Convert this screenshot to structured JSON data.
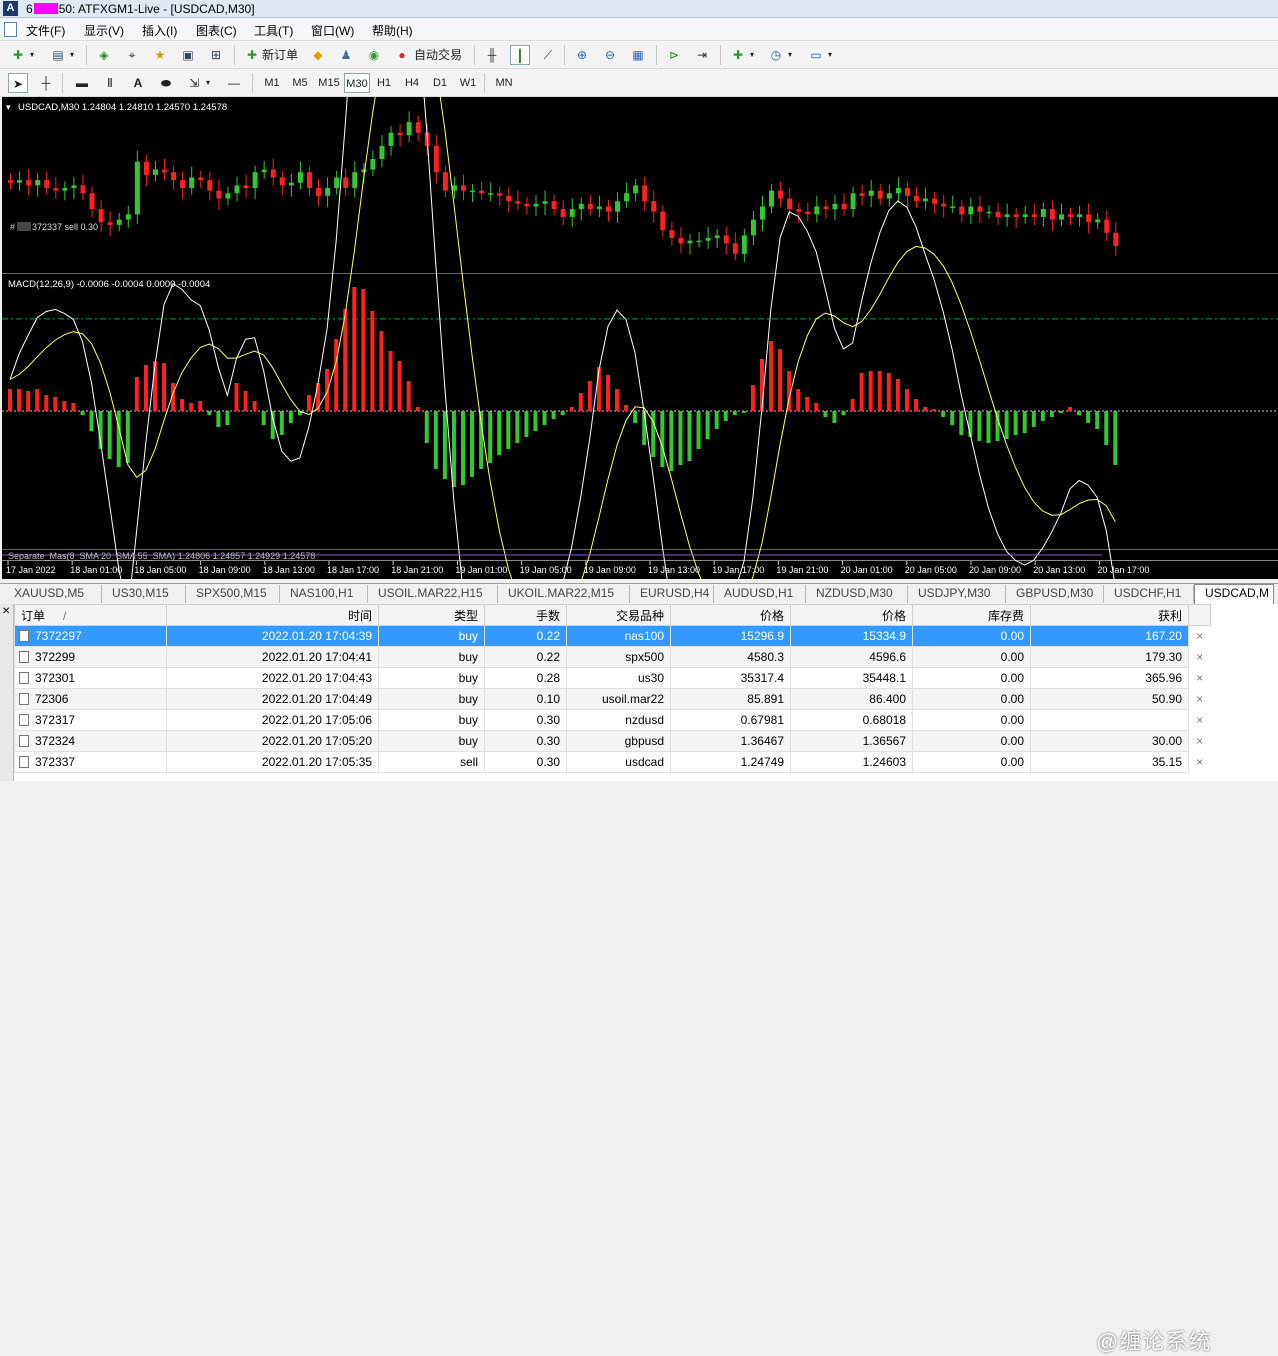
{
  "window": {
    "account_prefix": "6",
    "account_suffix": "50",
    "title_rest": ": ATFXGM1-Live - [USDCAD,M30]"
  },
  "menu": [
    "文件(F)",
    "显示(V)",
    "插入(I)",
    "图表(C)",
    "工具(T)",
    "窗口(W)",
    "帮助(H)"
  ],
  "toolbar": {
    "new_order": "新订单",
    "auto_trading": "自动交易",
    "timeframes": [
      "M1",
      "M5",
      "M15",
      "M30",
      "H1",
      "H4",
      "D1",
      "W1",
      "MN"
    ],
    "active_timeframe": "M30"
  },
  "chart": {
    "header": "USDCAD,M30  1.24804 1.24810 1.24570 1.24578",
    "order_line_label": "372337 sell 0.30",
    "order_line_prefix": "#",
    "indicator_header": "MACD(12,26,9) -0.0006 -0.0004 0.0000 -0.0004",
    "bottom_indicator_header": "Separate_Mas(8_SMA 20_SMA 55_SMA) 1.24806 1.24857 1.24929 1.24578",
    "time_labels": [
      "17 Jan 2022",
      "18 Jan 01:00",
      "18 Jan 05:00",
      "18 Jan 09:00",
      "18 Jan 13:00",
      "18 Jan 17:00",
      "18 Jan 21:00",
      "19 Jan 01:00",
      "19 Jan 05:00",
      "19 Jan 09:00",
      "19 Jan 13:00",
      "19 Jan 17:00",
      "19 Jan 21:00",
      "20 Jan 01:00",
      "20 Jan 05:00",
      "20 Jan 09:00",
      "20 Jan 13:00",
      "20 Jan 17:00"
    ],
    "colors": {
      "bull": "#32c832",
      "bear": "#ff2020",
      "macd_line": "#ffffff",
      "signal": "#ffff66",
      "order_line": "#1e9e3c"
    }
  },
  "chart_data": {
    "type": "candlestick",
    "symbol": "USDCAD",
    "timeframe": "M30",
    "closes": [
      1.2512,
      1.2513,
      1.2511,
      1.2513,
      1.251,
      1.2509,
      1.251,
      1.2511,
      1.2508,
      1.2502,
      1.2497,
      1.2496,
      1.2498,
      1.25,
      1.252,
      1.2515,
      1.2517,
      1.2516,
      1.2513,
      1.251,
      1.2514,
      1.2513,
      1.2509,
      1.2506,
      1.2508,
      1.2511,
      1.251,
      1.2516,
      1.2517,
      1.2514,
      1.2511,
      1.2512,
      1.2516,
      1.251,
      1.2507,
      1.251,
      1.2514,
      1.251,
      1.2516,
      1.2517,
      1.2521,
      1.2526,
      1.2531,
      1.253,
      1.2535,
      1.2531,
      1.2526,
      1.2516,
      1.2509,
      1.2511,
      1.2509,
      1.2509,
      1.2508,
      1.2508,
      1.2507,
      1.2505,
      1.2504,
      1.2503,
      1.2504,
      1.2505,
      1.2502,
      1.2499,
      1.2502,
      1.2504,
      1.2502,
      1.2503,
      1.2501,
      1.2505,
      1.2508,
      1.2511,
      1.2505,
      1.2501,
      1.2494,
      1.2491,
      1.2489,
      1.249,
      1.249,
      1.2491,
      1.2492,
      1.2489,
      1.2485,
      1.2492,
      1.2498,
      1.2503,
      1.2509,
      1.2506,
      1.2502,
      1.2501,
      1.25,
      1.2503,
      1.2502,
      1.2504,
      1.2502,
      1.2508,
      1.2507,
      1.2509,
      1.2506,
      1.2508,
      1.251,
      1.2507,
      1.2505,
      1.2506,
      1.2504,
      1.2503,
      1.2503,
      1.25,
      1.2503,
      1.2501,
      1.2501,
      1.2499,
      1.25,
      1.2499,
      1.25,
      1.2499,
      1.2502,
      1.2498,
      1.25,
      1.2499,
      1.25,
      1.2497,
      1.2498,
      1.2493,
      1.2488
    ],
    "order_line_price": 1.24603,
    "macd_hist": [
      0.00011,
      0.00011,
      0.0001,
      0.00011,
      8e-05,
      7e-05,
      5e-05,
      4e-05,
      -2e-05,
      -0.0001,
      -0.00019,
      -0.00024,
      -0.00028,
      -0.00026,
      0.00017,
      0.00023,
      0.00025,
      0.00024,
      0.00014,
      6e-05,
      4e-05,
      5e-05,
      -2e-05,
      -8e-05,
      -7e-05,
      0.00014,
      0.0001,
      5e-05,
      -7e-05,
      -0.00014,
      -0.00012,
      -6e-05,
      -2e-05,
      8e-05,
      0.00014,
      0.00021,
      0.00036,
      0.00051,
      0.00062,
      0.00061,
      0.0005,
      0.0004,
      0.0003,
      0.00025,
      0.00015,
      2e-05,
      -0.00016,
      -0.00029,
      -0.00034,
      -0.00038,
      -0.00037,
      -0.00033,
      -0.00029,
      -0.00026,
      -0.00022,
      -0.00019,
      -0.00016,
      -0.00013,
      -0.0001,
      -7e-05,
      -4e-05,
      -2e-05,
      2e-05,
      9e-05,
      0.00015,
      0.00022,
      0.00018,
      0.00011,
      3e-05,
      -6e-05,
      -0.00017,
      -0.00023,
      -0.00028,
      -0.0003,
      -0.00027,
      -0.00025,
      -0.00019,
      -0.00014,
      -9e-05,
      -5e-05,
      -2e-05,
      -1e-05,
      0.00013,
      0.00026,
      0.00035,
      0.00031,
      0.0002,
      0.00011,
      7e-05,
      4e-05,
      -3e-05,
      -6e-05,
      -2e-05,
      6e-05,
      0.00019,
      0.0002,
      0.0002,
      0.00019,
      0.00016,
      0.00011,
      6e-05,
      2e-05,
      1e-05,
      -3e-05,
      -7e-05,
      -0.00012,
      -0.00013,
      -0.00015,
      -0.00016,
      -0.00015,
      -0.00014,
      -0.00012,
      -0.00011,
      -8e-05,
      -5e-05,
      -3e-05,
      -1e-05,
      2e-05,
      -2e-05,
      -6e-05,
      -9e-05,
      -0.00017,
      -0.00027
    ],
    "macd_zero": 0
  },
  "tabs": [
    "XAUUSD,M5",
    "US30,M15",
    "SPX500,M15",
    "NAS100,H1",
    "USOIL.MAR22,H15",
    "UKOIL.MAR22,M15",
    "EURUSD,H4",
    "AUDUSD,H1",
    "NZDUSD,M30",
    "USDJPY,M30",
    "GBPUSD,M30",
    "USDCHF,H1",
    "USDCAD,M"
  ],
  "active_tab": 12,
  "orders": {
    "columns": [
      "订单",
      "时间",
      "类型",
      "手数",
      "交易品种",
      "价格",
      "价格",
      "库存费",
      "获利"
    ],
    "sort_marker": "/",
    "rows": [
      {
        "order": "7372297",
        "time": "2022.01.20 17:04:39",
        "type": "buy",
        "lots": "0.22",
        "symbol": "nas100",
        "open": "15296.9",
        "price": "15334.9",
        "swap": "0.00",
        "profit": "167.20"
      },
      {
        "order": "372299",
        "time": "2022.01.20 17:04:41",
        "type": "buy",
        "lots": "0.22",
        "symbol": "spx500",
        "open": "4580.3",
        "price": "4596.6",
        "swap": "0.00",
        "profit": "179.30"
      },
      {
        "order": "372301",
        "time": "2022.01.20 17:04:43",
        "type": "buy",
        "lots": "0.28",
        "symbol": "us30",
        "open": "35317.4",
        "price": "35448.1",
        "swap": "0.00",
        "profit": "365.96"
      },
      {
        "order": "72306",
        "time": "2022.01.20 17:04:49",
        "type": "buy",
        "lots": "0.10",
        "symbol": "usoil.mar22",
        "open": "85.891",
        "price": "86.400",
        "swap": "0.00",
        "profit": "50.90"
      },
      {
        "order": "372317",
        "time": "2022.01.20 17:05:06",
        "type": "buy",
        "lots": "0.30",
        "symbol": "nzdusd",
        "open": "0.67981",
        "price": "0.68018",
        "swap": "0.00",
        "profit": ""
      },
      {
        "order": "372324",
        "time": "2022.01.20 17:05:20",
        "type": "buy",
        "lots": "0.30",
        "symbol": "gbpusd",
        "open": "1.36467",
        "price": "1.36567",
        "swap": "0.00",
        "profit": "30.00"
      },
      {
        "order": "372337",
        "time": "2022.01.20 17:05:35",
        "type": "sell",
        "lots": "0.30",
        "symbol": "usdcad",
        "open": "1.24749",
        "price": "1.24603",
        "swap": "0.00",
        "profit": "35.15"
      }
    ],
    "close_glyph": "×"
  },
  "watermark": "@缠论系统"
}
